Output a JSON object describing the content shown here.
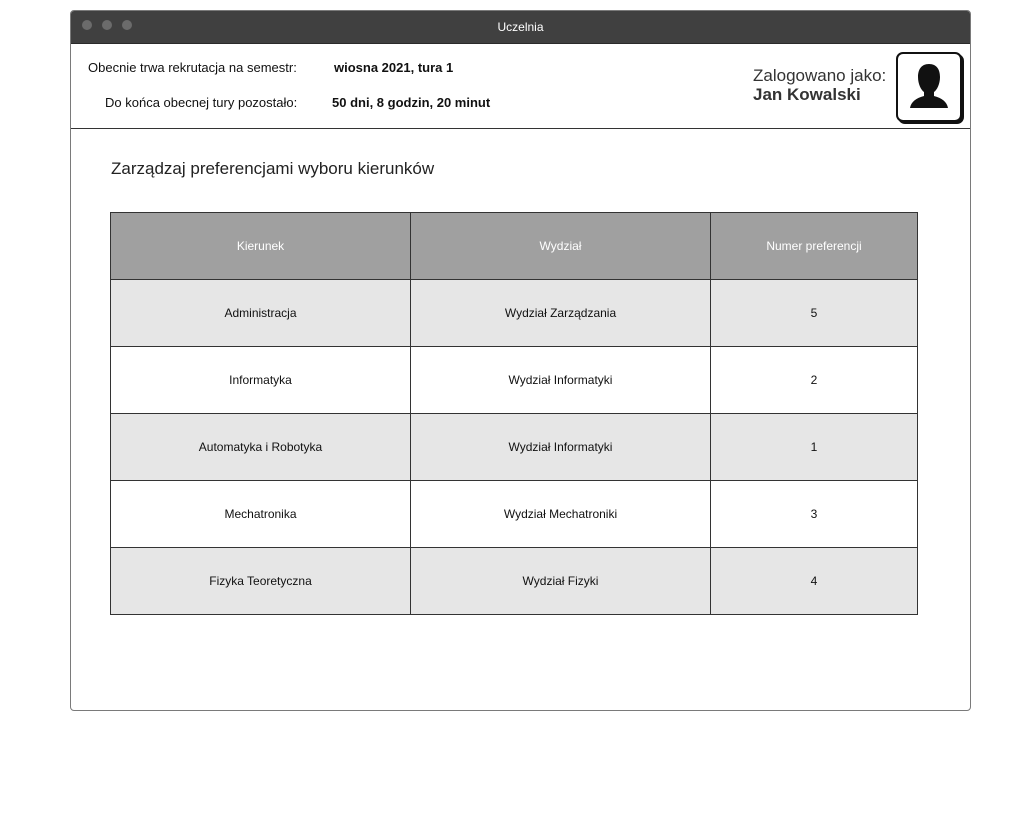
{
  "window": {
    "title": "Uczelnia"
  },
  "header": {
    "semester_label": "Obecnie trwa rekrutacja na semestr:",
    "semester_value": "wiosna 2021, tura 1",
    "remaining_label": "Do końca obecnej tury pozostało:",
    "remaining_value": "50 dni, 8 godzin, 20 minut",
    "logged_in_label": "Zalogowano jako:",
    "user_name": "Jan Kowalski",
    "avatar_icon": "user-silhouette-icon"
  },
  "main": {
    "title": "Zarządzaj preferencjami wyboru kierunków",
    "table": {
      "headers": [
        "Kierunek",
        "Wydział",
        "Numer preferencji"
      ],
      "rows": [
        [
          "Administracja",
          "Wydział Zarządzania",
          "5"
        ],
        [
          "Informatyka",
          "Wydział Informatyki",
          "2"
        ],
        [
          "Automatyka i Robotyka",
          "Wydział Informatyki",
          "1"
        ],
        [
          "Mechatronika",
          "Wydział Mechatroniki",
          "3"
        ],
        [
          "Fizyka Teoretyczna",
          "Wydział Fizyki",
          "4"
        ]
      ]
    }
  },
  "colors": {
    "titlebar": "#404040",
    "table_header": "#a0a0a0",
    "row_shaded": "#e6e6e6"
  }
}
